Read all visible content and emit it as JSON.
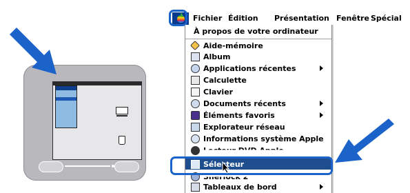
{
  "menubar": {
    "apple_menu": "apple-logo-icon",
    "titles": [
      "Fichier",
      "Édition",
      "Présentation",
      "Fenêtre",
      "Spécial"
    ]
  },
  "apple_menu": {
    "about": "À propos de votre ordinateur",
    "items": [
      {
        "label": "Aide-mémoire",
        "icon": "note-pad-icon",
        "submenu": false
      },
      {
        "label": "Album",
        "icon": "album-icon",
        "submenu": false
      },
      {
        "label": "Applications récentes",
        "icon": "recent-apps-icon",
        "submenu": true
      },
      {
        "label": "Calculette",
        "icon": "calculator-icon",
        "submenu": false
      },
      {
        "label": "Clavier",
        "icon": "keyboard-icon",
        "submenu": false
      },
      {
        "label": "Documents récents",
        "icon": "recent-docs-icon",
        "submenu": true
      },
      {
        "label": "Éléments favoris",
        "icon": "favorites-icon",
        "submenu": true
      },
      {
        "label": "Explorateur réseau",
        "icon": "network-browser-icon",
        "submenu": false
      },
      {
        "label": "Informations système Apple",
        "icon": "system-info-icon",
        "submenu": false
      },
      {
        "label": "Lecteur DVD Apple",
        "icon": "dvd-player-icon",
        "submenu": false
      },
      {
        "label": "Sélecteur",
        "icon": "chooser-icon",
        "submenu": false,
        "selected": true
      },
      {
        "label": "Sherlock 2",
        "icon": "sherlock-icon",
        "submenu": false
      },
      {
        "label": "Tableaux de bord",
        "icon": "control-panels-icon",
        "submenu": true
      }
    ]
  },
  "colors": {
    "highlight_outline": "#1c63c9",
    "arrow": "#1c63c9",
    "selected_row": "#1f4e8f",
    "apple_button": "#0a3a8c"
  }
}
